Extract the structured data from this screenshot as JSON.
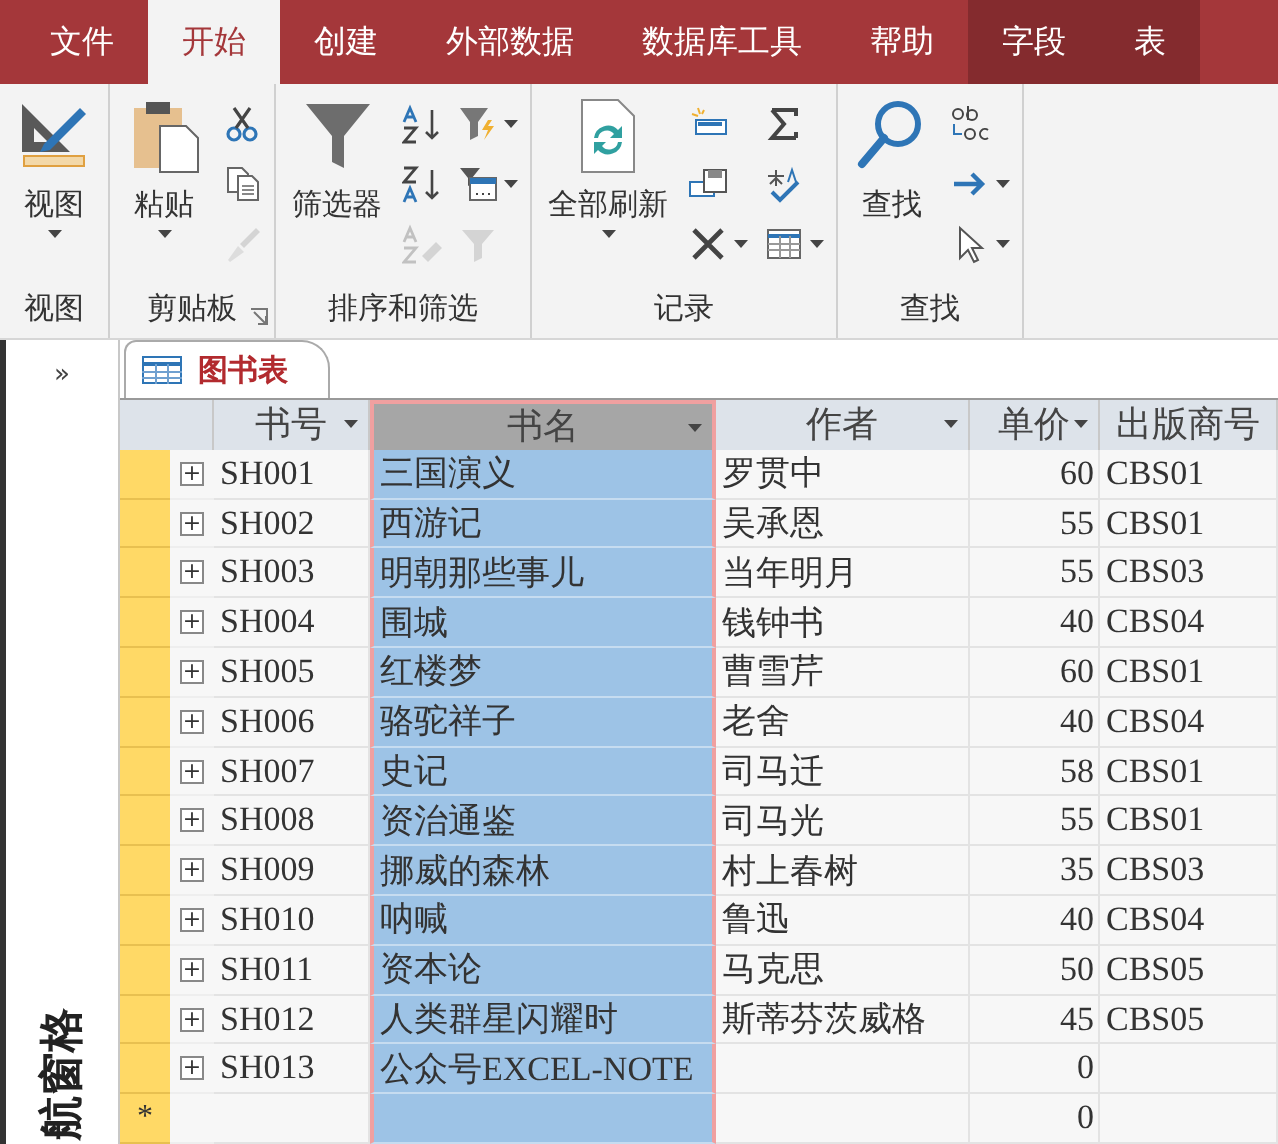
{
  "ribbon_tabs": [
    {
      "label": "文件",
      "selected": false,
      "kind": "standard"
    },
    {
      "label": "开始",
      "selected": true,
      "kind": "standard"
    },
    {
      "label": "创建",
      "selected": false,
      "kind": "standard"
    },
    {
      "label": "外部数据",
      "selected": false,
      "kind": "standard"
    },
    {
      "label": "数据库工具",
      "selected": false,
      "kind": "standard"
    },
    {
      "label": "帮助",
      "selected": false,
      "kind": "standard"
    },
    {
      "label": "字段",
      "selected": false,
      "kind": "contextual"
    },
    {
      "label": "表",
      "selected": false,
      "kind": "contextual"
    }
  ],
  "ribbon_groups": [
    {
      "label": "视图",
      "launcher": false,
      "large_button": {
        "kind": "view",
        "label": "视图",
        "dropdown": true
      }
    },
    {
      "label": "剪贴板",
      "launcher": true,
      "large_button": {
        "kind": "paste",
        "label": "粘贴",
        "dropdown": true
      },
      "small_columns": [
        [
          {
            "kind": "cut",
            "dropdown": false,
            "disabled": false
          },
          {
            "kind": "copy",
            "dropdown": false,
            "disabled": false
          },
          {
            "kind": "painter",
            "dropdown": false,
            "disabled": true
          }
        ]
      ]
    },
    {
      "label": "排序和筛选",
      "launcher": false,
      "large_button": {
        "kind": "filter",
        "label": "筛选器",
        "dropdown": false
      },
      "small_columns": [
        [
          {
            "kind": "sort_asc",
            "dropdown": false,
            "disabled": false
          },
          {
            "kind": "sort_desc",
            "dropdown": false,
            "disabled": false
          },
          {
            "kind": "clear_sort",
            "dropdown": false,
            "disabled": true
          }
        ],
        [
          {
            "kind": "selection",
            "dropdown": true,
            "disabled": false
          },
          {
            "kind": "advanced",
            "dropdown": true,
            "disabled": false
          },
          {
            "kind": "toggle_filter",
            "dropdown": false,
            "disabled": true
          }
        ]
      ]
    },
    {
      "label": "记录",
      "launcher": false,
      "large_button": {
        "kind": "refresh",
        "label": "全部刷新",
        "dropdown": true
      },
      "small_columns": [
        [
          {
            "kind": "new_record",
            "dropdown": false,
            "disabled": false
          },
          {
            "kind": "save",
            "dropdown": false,
            "disabled": false
          },
          {
            "kind": "delete",
            "dropdown": true,
            "disabled": false
          }
        ],
        [
          {
            "kind": "sum",
            "dropdown": false,
            "disabled": false
          },
          {
            "kind": "spelling",
            "dropdown": false,
            "disabled": false
          },
          {
            "kind": "more",
            "dropdown": true,
            "disabled": false
          }
        ]
      ]
    },
    {
      "label": "查找",
      "launcher": false,
      "large_button": {
        "kind": "find",
        "label": "查找",
        "dropdown": false
      },
      "small_columns": [
        [
          {
            "kind": "replace",
            "dropdown": false,
            "disabled": false
          },
          {
            "kind": "goto",
            "dropdown": true,
            "disabled": false
          },
          {
            "kind": "select",
            "dropdown": true,
            "disabled": false
          }
        ]
      ]
    }
  ],
  "nav_pane": {
    "toggle": "»",
    "label": "航窗格"
  },
  "document_tab": {
    "label": "图书表",
    "selected": true
  },
  "table": {
    "columns": [
      {
        "label": "书号",
        "filter": true,
        "selected": false,
        "kind": "text"
      },
      {
        "label": "书名",
        "filter": true,
        "selected": true,
        "kind": "text"
      },
      {
        "label": "作者",
        "filter": true,
        "selected": false,
        "kind": "text"
      },
      {
        "label": "单价",
        "filter": true,
        "selected": false,
        "kind": "number"
      },
      {
        "label": "出版商号",
        "filter": false,
        "selected": false,
        "kind": "text"
      }
    ],
    "rows": [
      {
        "expand": "+",
        "cells": [
          "SH001",
          "三国演义",
          "罗贯中",
          "60",
          "CBS01"
        ]
      },
      {
        "expand": "+",
        "cells": [
          "SH002",
          "西游记",
          "吴承恩",
          "55",
          "CBS01"
        ]
      },
      {
        "expand": "+",
        "cells": [
          "SH003",
          "明朝那些事儿",
          "当年明月",
          "55",
          "CBS03"
        ]
      },
      {
        "expand": "+",
        "cells": [
          "SH004",
          "围城",
          "钱钟书",
          "40",
          "CBS04"
        ]
      },
      {
        "expand": "+",
        "cells": [
          "SH005",
          "红楼梦",
          "曹雪芹",
          "60",
          "CBS01"
        ]
      },
      {
        "expand": "+",
        "cells": [
          "SH006",
          "骆驼祥子",
          "老舍",
          "40",
          "CBS04"
        ]
      },
      {
        "expand": "+",
        "cells": [
          "SH007",
          "史记",
          "司马迁",
          "58",
          "CBS01"
        ]
      },
      {
        "expand": "+",
        "cells": [
          "SH008",
          "资治通鉴",
          "司马光",
          "55",
          "CBS01"
        ]
      },
      {
        "expand": "+",
        "cells": [
          "SH009",
          "挪威的森林",
          "村上春树",
          "35",
          "CBS03"
        ]
      },
      {
        "expand": "+",
        "cells": [
          "SH010",
          "呐喊",
          "鲁迅",
          "40",
          "CBS04"
        ]
      },
      {
        "expand": "+",
        "cells": [
          "SH011",
          "资本论",
          "马克思",
          "50",
          "CBS05"
        ]
      },
      {
        "expand": "+",
        "cells": [
          "SH012",
          "人类群星闪耀时",
          "斯蒂芬茨威格",
          "45",
          "CBS05"
        ]
      },
      {
        "expand": "+",
        "cells": [
          "SH013",
          "公众号EXCEL-NOTE",
          "",
          "0",
          ""
        ]
      }
    ],
    "new_row": {
      "marker": "*",
      "price": "0"
    }
  }
}
